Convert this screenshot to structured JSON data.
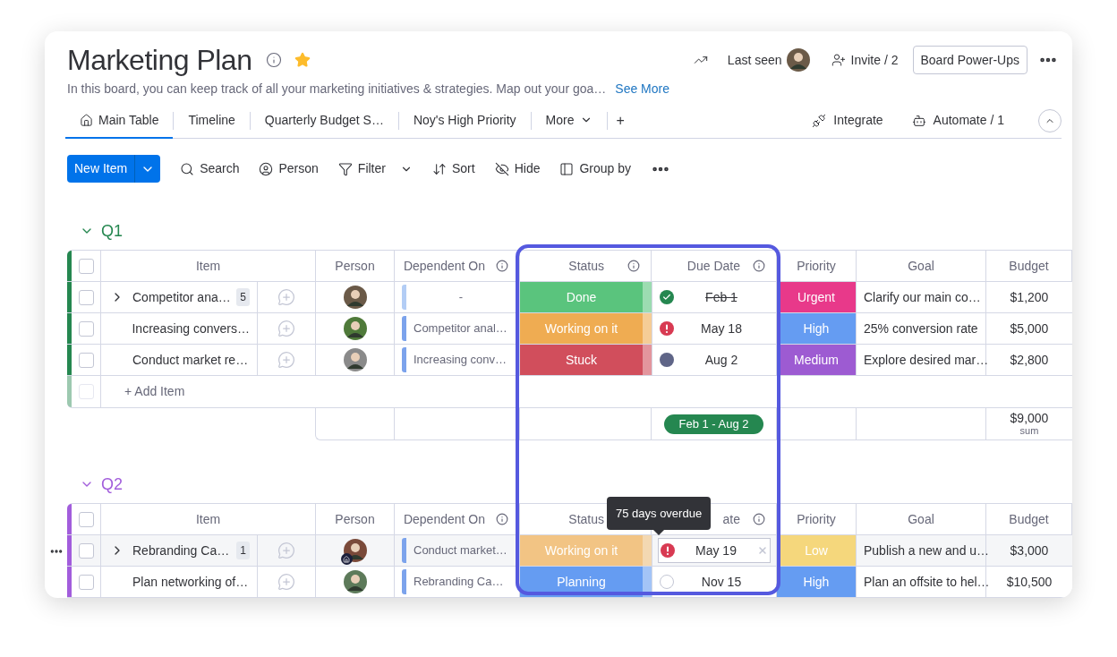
{
  "board": {
    "title": "Marketing Plan",
    "starred": true,
    "description": "In this board, you can keep track of all your marketing initiatives & strategies. Map out your goa…",
    "see_more": "See More"
  },
  "header_actions": {
    "last_seen": "Last seen",
    "invite": "Invite / 2",
    "power_ups": "Board Power-Ups"
  },
  "tabs": [
    {
      "label": "Main Table",
      "selected": true,
      "kind": "home"
    },
    {
      "label": "Timeline",
      "selected": false,
      "kind": "view"
    },
    {
      "label": "Quarterly Budget S…",
      "selected": false,
      "kind": "view"
    },
    {
      "label": "Noy's High Priority",
      "selected": false,
      "kind": "view"
    },
    {
      "label": "More",
      "selected": false,
      "kind": "menu"
    }
  ],
  "add_view": "+",
  "view_actions": {
    "integrate": "Integrate",
    "automate": "Automate / 1"
  },
  "toolbar": {
    "new_item": "New Item",
    "tools": [
      {
        "label": "Search",
        "kind": "search"
      },
      {
        "label": "Person",
        "kind": "person"
      },
      {
        "label": "Filter",
        "kind": "filter"
      },
      {
        "label": "Sort",
        "kind": "sort"
      },
      {
        "label": "Hide",
        "kind": "hide"
      },
      {
        "label": "Group by",
        "kind": "group"
      }
    ]
  },
  "groups": [
    {
      "title": "Q1",
      "color": "#258750",
      "select_all_checked": false,
      "columns": [
        {
          "label": "Item",
          "info": false
        },
        {
          "label": "Person",
          "info": false
        },
        {
          "label": "Dependent On",
          "info": true
        },
        {
          "label": "Status",
          "info": true
        },
        {
          "label": "Due Date",
          "info": true
        },
        {
          "label": "Priority",
          "info": false
        },
        {
          "label": "Goal",
          "info": false
        },
        {
          "label": "Budget",
          "info": false
        }
      ],
      "rows": [
        {
          "checked": false,
          "hovered": false,
          "item": "Competitor ana…",
          "subitems": "5",
          "home_badge": false,
          "dependent_on": "-",
          "linked": false,
          "status": {
            "label": "Done",
            "color": "#5ac47d"
          },
          "due": {
            "date": "Feb 1",
            "kind": "done"
          },
          "priority": {
            "label": "Urgent",
            "color": "#e8398a"
          },
          "goal": "Clarify our main co…",
          "budget": "$1,200"
        },
        {
          "checked": false,
          "hovered": false,
          "item": "Increasing convers…",
          "home_badge": false,
          "dependent_on": "Competitor anal…",
          "linked": true,
          "status": {
            "label": "Working on it",
            "color": "#efac52"
          },
          "due": {
            "date": "May 18",
            "kind": "overdue"
          },
          "priority": {
            "label": "High",
            "color": "#659cf2"
          },
          "goal": "25% conversion rate",
          "budget": "$5,000"
        },
        {
          "checked": false,
          "hovered": false,
          "item": "Conduct market re…",
          "home_badge": false,
          "dependent_on": "Increasing conv…",
          "linked": true,
          "status": {
            "label": "Stuck",
            "color": "#d14e5c"
          },
          "due": {
            "date": "Aug 2",
            "kind": "pending"
          },
          "priority": {
            "label": "Medium",
            "color": "#9d5bd2"
          },
          "goal": "Explore desired mar…",
          "budget": "$2,800"
        }
      ],
      "add_item": {
        "label": "+ Add Item",
        "checked": false
      },
      "summary": {
        "date_range": "Feb 1 - Aug 2",
        "budget": "$9,000",
        "budget_label": "sum"
      }
    },
    {
      "title": "Q2",
      "color": "#a25ddc",
      "select_all_checked": false,
      "columns": [
        {
          "label": "Item",
          "info": false
        },
        {
          "label": "Person",
          "info": false
        },
        {
          "label": "Dependent On",
          "info": true
        },
        {
          "label": "Status"
        },
        {
          "label": "ate",
          "info": true
        },
        {
          "label": "Priority",
          "info": false
        },
        {
          "label": "Goal",
          "info": false
        },
        {
          "label": "Budget",
          "info": false
        }
      ],
      "rows": [
        {
          "checked": false,
          "hovered": true,
          "item": "Rebranding Ca…",
          "subitems": "1",
          "home_badge": true,
          "dependent_on": "Conduct market…",
          "linked": true,
          "status": {
            "label": "Working on it",
            "color": "#f2c484"
          },
          "due": {
            "date": "May 19",
            "kind": "overdue"
          },
          "priority": {
            "label": "Low",
            "color": "#f5d77c"
          },
          "goal": "Publish a new and u…",
          "budget": "$3,000"
        },
        {
          "checked": false,
          "hovered": false,
          "item": "Plan networking of…",
          "home_badge": false,
          "dependent_on": "Rebranding Ca…",
          "linked": true,
          "status": {
            "label": "Planning",
            "color": "#659cf2"
          },
          "due": {
            "date": "Nov 15",
            "kind": "open"
          },
          "priority": {
            "label": "High",
            "color": "#659cf2"
          },
          "goal": "Plan an offsite to hel…",
          "budget": "$10,500"
        }
      ]
    }
  ],
  "tooltip": {
    "text": "75 days overdue"
  }
}
